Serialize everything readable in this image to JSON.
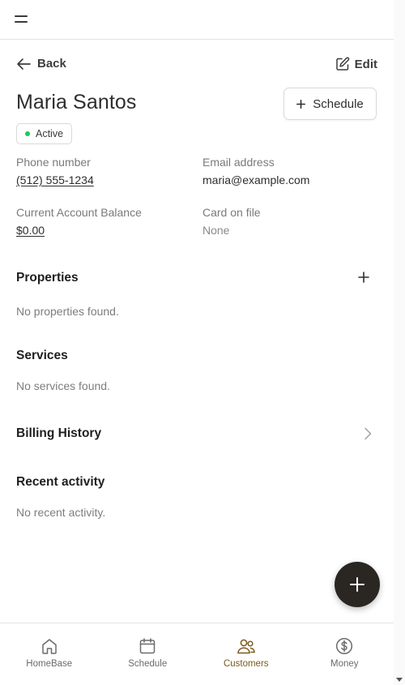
{
  "header": {
    "menu_icon": "hamburger-menu-icon"
  },
  "nav": {
    "back_label": "Back",
    "edit_label": "Edit"
  },
  "customer": {
    "name": "Maria Santos",
    "status": "Active",
    "status_color": "#22c55e",
    "schedule_label": "Schedule"
  },
  "details": {
    "phone_label": "Phone number",
    "phone_value": "(512) 555-1234",
    "email_label": "Email address",
    "email_value": "maria@example.com",
    "balance_label": "Current Account Balance",
    "balance_value": "$0.00",
    "card_label": "Card on file",
    "card_value": "None"
  },
  "sections": {
    "properties_title": "Properties",
    "properties_empty": "No properties found.",
    "services_title": "Services",
    "services_empty": "No services found.",
    "billing_title": "Billing History",
    "activity_title": "Recent activity",
    "activity_empty": "No recent activity."
  },
  "fab": {
    "icon": "plus-icon"
  },
  "bottom_nav": {
    "items": [
      {
        "label": "HomeBase",
        "icon": "home-icon"
      },
      {
        "label": "Schedule",
        "icon": "calendar-icon"
      },
      {
        "label": "Customers",
        "icon": "users-icon",
        "active": true
      },
      {
        "label": "Money",
        "icon": "dollar-circle-icon"
      }
    ],
    "active_color": "#7a5a1e"
  }
}
